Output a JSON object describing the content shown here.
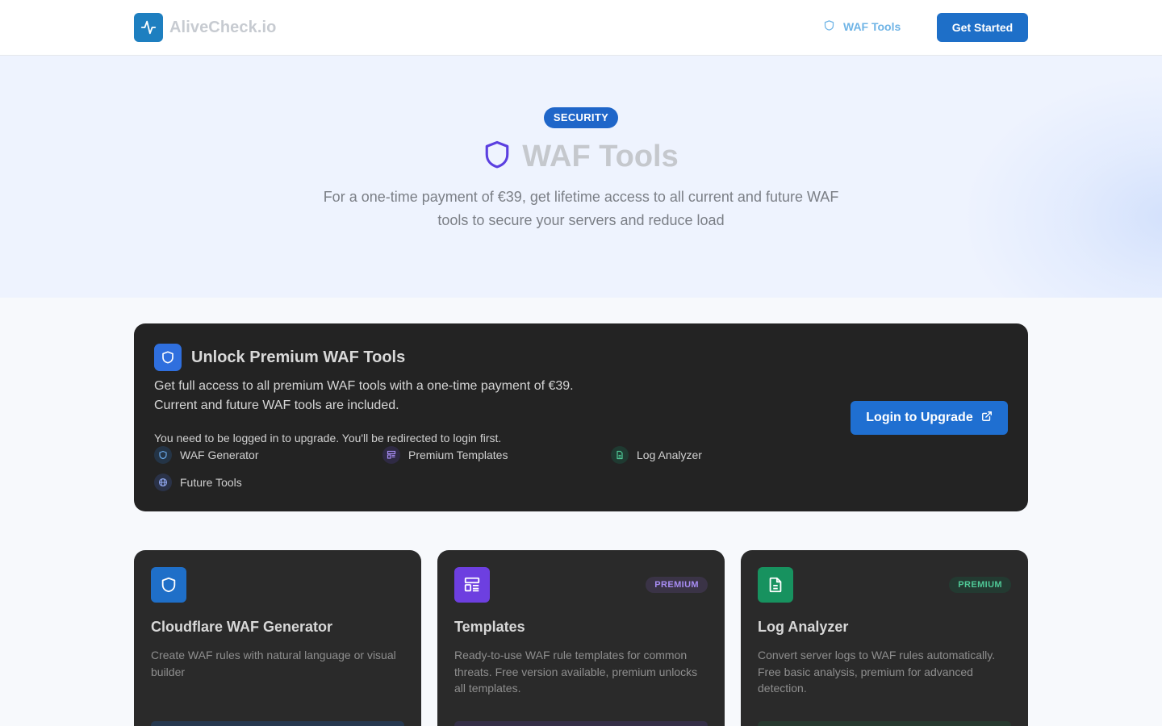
{
  "header": {
    "logo_text": "AliveCheck.io",
    "nav_waf_label": "WAF Tools",
    "get_started_label": "Get Started"
  },
  "hero": {
    "badge": "SECURITY",
    "title": "WAF Tools",
    "subtitle": "For a one-time payment of €39, get lifetime access to all current and future WAF tools to secure your servers and reduce load"
  },
  "unlock": {
    "title": "Unlock Premium WAF Tools",
    "description": "Get full access to all premium WAF tools with a one-time payment of €39. Current and future WAF tools are included.",
    "note": "You need to be logged in to upgrade. You'll be redirected to login first.",
    "features": [
      {
        "label": "WAF Generator",
        "icon": "shield-icon"
      },
      {
        "label": "Premium Templates",
        "icon": "template-icon"
      },
      {
        "label": "Log Analyzer",
        "icon": "file-text-icon"
      },
      {
        "label": "Future Tools",
        "icon": "globe-icon"
      }
    ],
    "button_label": "Login to Upgrade"
  },
  "cards": [
    {
      "title": "Cloudflare WAF Generator",
      "description": "Create WAF rules with natural language or visual builder",
      "badge": "",
      "icon": "shield-icon",
      "accent": "#1f6fc8"
    },
    {
      "title": "Templates",
      "description": "Ready-to-use WAF rule templates for common threats. Free version available, premium unlocks all templates.",
      "badge": "PREMIUM",
      "icon": "template-icon",
      "accent": "#6d3fe0"
    },
    {
      "title": "Log Analyzer",
      "description": "Convert server logs to WAF rules automatically. Free basic analysis, premium for advanced detection.",
      "badge": "PREMIUM",
      "icon": "file-text-icon",
      "accent": "#17925f"
    }
  ],
  "colors": {
    "brand": "#1e7fc0",
    "primary_button": "#1f6fd1",
    "security_badge": "#1f66c9",
    "panel_bg": "#232323",
    "card_bg": "#2a2a2a"
  }
}
